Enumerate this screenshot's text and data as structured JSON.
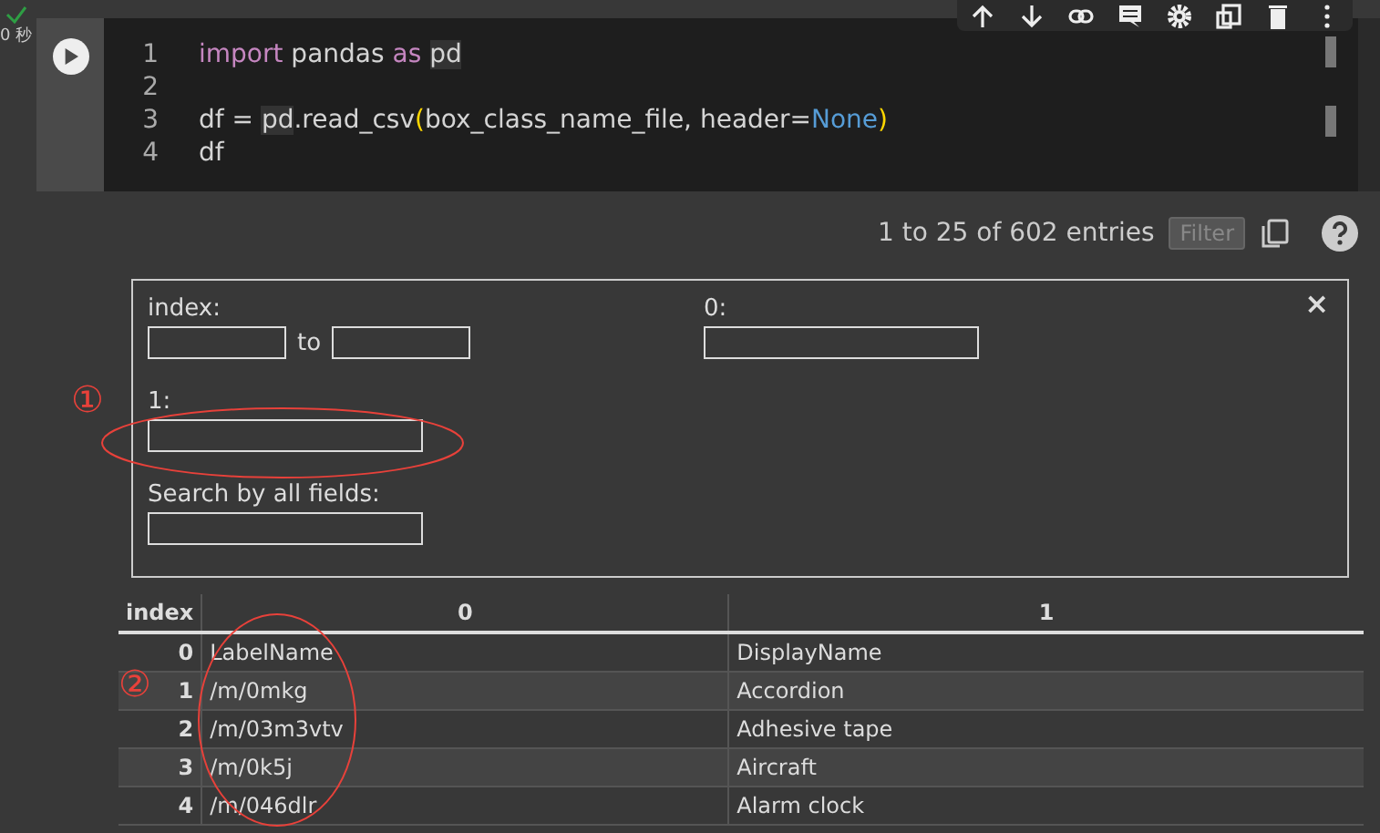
{
  "cell": {
    "status": "0 秒",
    "code_lines": [
      {
        "number": "1",
        "tokens": [
          {
            "kind": "keyword",
            "text": "import"
          },
          {
            "kind": "plain",
            "text": " pandas "
          },
          {
            "kind": "keyword",
            "text": "as "
          },
          {
            "kind": "match",
            "text": "pd"
          }
        ]
      },
      {
        "number": "2"
      },
      {
        "number": "3",
        "tokens": [
          {
            "kind": "plain",
            "text": "df = "
          },
          {
            "kind": "match",
            "text": "pd"
          },
          {
            "kind": "plain",
            "text": ".read_csv"
          },
          {
            "kind": "bracket",
            "text": "("
          },
          {
            "kind": "plain",
            "text": "box_class_name_file, header="
          },
          {
            "kind": "constant",
            "text": "None"
          },
          {
            "kind": "bracket",
            "text": ")"
          }
        ]
      },
      {
        "number": "4",
        "tokens": [
          {
            "kind": "plain",
            "text": "df"
          }
        ]
      }
    ]
  },
  "output": {
    "entries": "1 to 25 of 602 entries",
    "filter_button": "Filter",
    "filter_panel": {
      "close": "×",
      "annotation": "①",
      "fields": [
        {
          "label": "index:",
          "kind": "range",
          "joiner": "to"
        },
        {
          "label": "0:",
          "kind": "text"
        },
        {
          "label": "1:",
          "kind": "text"
        },
        {
          "label": "Search by all fields:",
          "kind": "text"
        }
      ]
    },
    "table": {
      "annotation": "②",
      "columns": [
        "index",
        "0",
        "1"
      ],
      "rows": [
        {
          "cells": [
            "0",
            "LabelName",
            "DisplayName"
          ]
        },
        {
          "cells": [
            "1",
            "/m/0mkg",
            "Accordion"
          ]
        },
        {
          "cells": [
            "2",
            "/m/03m3vtv",
            "Adhesive tape"
          ]
        },
        {
          "cells": [
            "3",
            "/m/0k5j",
            "Aircraft"
          ]
        },
        {
          "cells": [
            "4",
            "/m/046dlr",
            "Alarm clock"
          ]
        }
      ]
    }
  }
}
